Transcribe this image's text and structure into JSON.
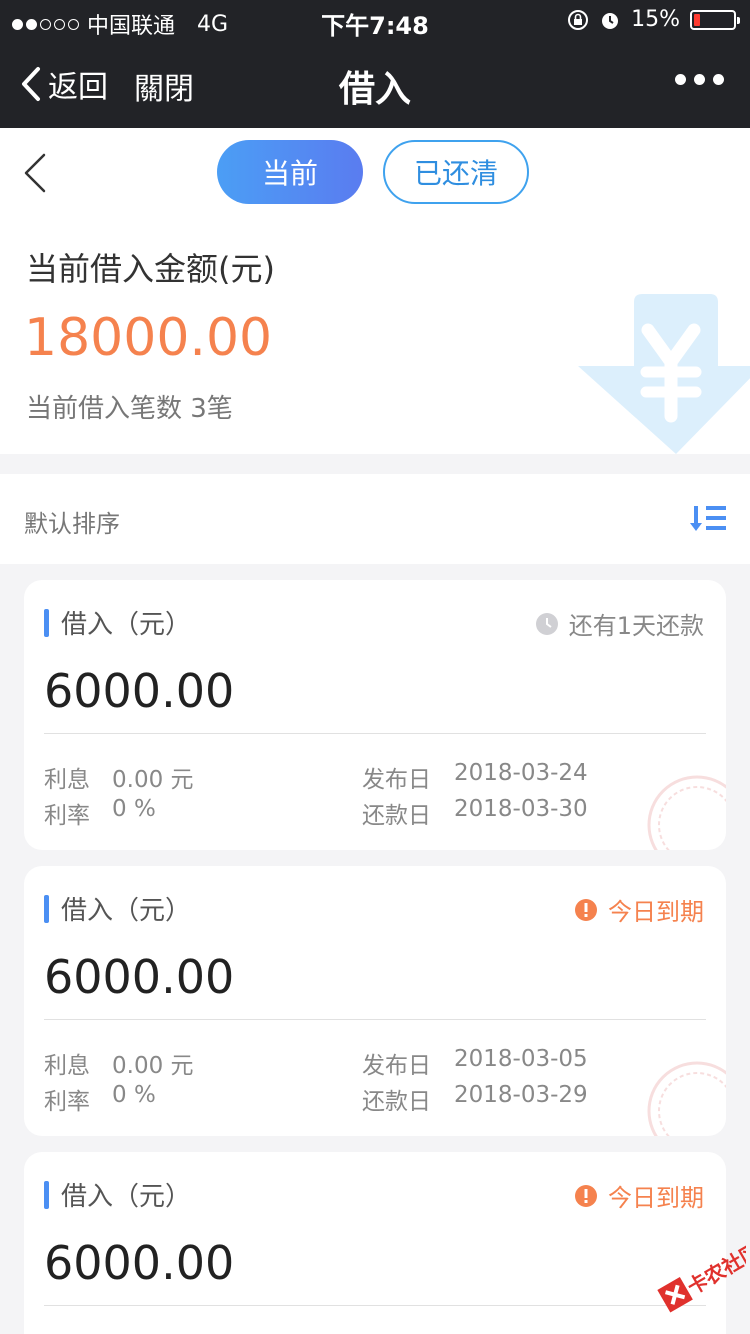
{
  "status_bar": {
    "carrier": "中国联通",
    "network": "4G",
    "time": "下午7:48",
    "battery": "15%",
    "battery_level": 0.15,
    "signal_bars": 2
  },
  "nav": {
    "back_label": "返回",
    "close_label": "關閉",
    "title": "借入"
  },
  "tabs": {
    "current": "当前",
    "cleared": "已还清"
  },
  "summary": {
    "amount_label": "当前借入金额(元)",
    "amount": "18000.00",
    "count_text": "当前借入笔数 3笔"
  },
  "sort": {
    "label": "默认排序"
  },
  "loans": [
    {
      "label": "借入（元）",
      "status": "还有1天还款",
      "amount": "6000.00",
      "interest_label": "利息",
      "interest": "0.00 元",
      "rate_label": "利率",
      "rate": "0 %",
      "publish_label": "发布日",
      "publish_date": "2018-03-24",
      "repay_label": "还款日",
      "repay_date": "2018-03-30"
    },
    {
      "label": "借入（元）",
      "status": "今日到期",
      "amount": "6000.00",
      "interest_label": "利息",
      "interest": "0.00 元",
      "rate_label": "利率",
      "rate": "0 %",
      "publish_label": "发布日",
      "publish_date": "2018-03-05",
      "repay_label": "还款日",
      "repay_date": "2018-03-29"
    },
    {
      "label": "借入（元）",
      "status": "今日到期",
      "amount": "6000.00"
    }
  ],
  "watermark": {
    "text": "卡农社区"
  },
  "colors": {
    "accent_orange": "#f5824e",
    "accent_blue": "#4b8ff3",
    "nav_bg": "#222327"
  }
}
